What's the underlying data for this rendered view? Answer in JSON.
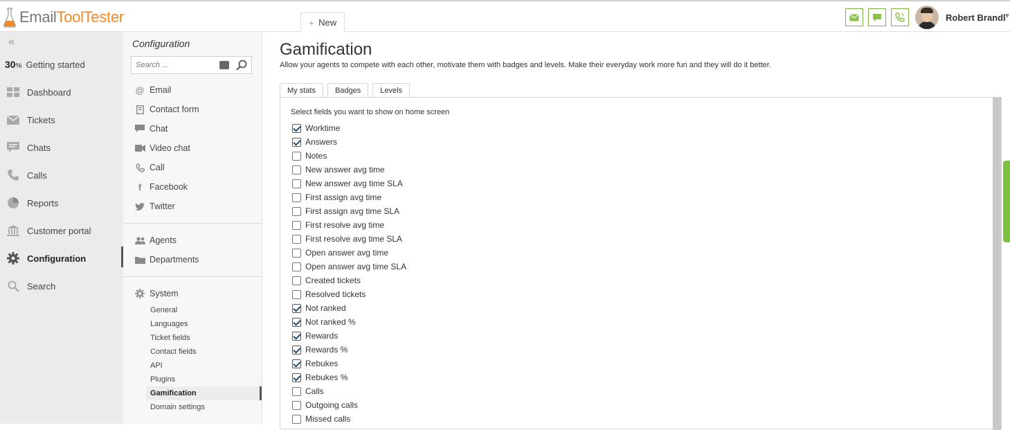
{
  "brand": {
    "part1": "Email",
    "part2": "ToolTester"
  },
  "header": {
    "new_tab_label": "New",
    "user_name": "Robert Brandl",
    "icons": [
      "email-icon",
      "chat-icon",
      "phone-icon"
    ],
    "accent_color": "#7cb342"
  },
  "leftnav": {
    "progress": {
      "percent": "30",
      "unit": "%",
      "label": "Getting started"
    },
    "items": [
      {
        "label": "Dashboard",
        "icon": "dashboard-icon"
      },
      {
        "label": "Tickets",
        "icon": "envelope-icon"
      },
      {
        "label": "Chats",
        "icon": "chat-bubble-icon"
      },
      {
        "label": "Calls",
        "icon": "phone-icon"
      },
      {
        "label": "Reports",
        "icon": "pie-chart-icon"
      },
      {
        "label": "Customer portal",
        "icon": "portal-icon"
      },
      {
        "label": "Configuration",
        "icon": "gear-icon",
        "active": true
      },
      {
        "label": "Search",
        "icon": "search-icon"
      }
    ]
  },
  "config": {
    "title": "Configuration",
    "search_placeholder": "Search ...",
    "channels": [
      {
        "label": "Email",
        "icon": "at-icon"
      },
      {
        "label": "Contact form",
        "icon": "form-icon"
      },
      {
        "label": "Chat",
        "icon": "chat-bubble-icon"
      },
      {
        "label": "Video chat",
        "icon": "video-icon"
      },
      {
        "label": "Call",
        "icon": "phone-icon"
      },
      {
        "label": "Facebook",
        "icon": "facebook-icon"
      },
      {
        "label": "Twitter",
        "icon": "twitter-icon"
      }
    ],
    "people": [
      {
        "label": "Agents",
        "icon": "agents-icon"
      },
      {
        "label": "Departments",
        "icon": "folder-icon"
      }
    ],
    "system": {
      "label": "System",
      "sub_items": [
        "General",
        "Languages",
        "Ticket fields",
        "Contact fields",
        "API",
        "Plugins",
        "Gamification",
        "Domain settings"
      ],
      "active": "Gamification"
    }
  },
  "main": {
    "title": "Gamification",
    "description": "Allow your agents to compete with each other, motivate them with badges and levels. Make their everyday work more fun and they will do it better.",
    "tabs": [
      "My stats",
      "Badges",
      "Levels"
    ],
    "active_tab": "My stats",
    "fields_label": "Select fields you want to show on home screen",
    "fields": [
      {
        "label": "Worktime",
        "checked": true
      },
      {
        "label": "Answers",
        "checked": true
      },
      {
        "label": "Notes",
        "checked": false
      },
      {
        "label": "New answer avg time",
        "checked": false
      },
      {
        "label": "New answer avg time SLA",
        "checked": false
      },
      {
        "label": "First assign avg time",
        "checked": false
      },
      {
        "label": "First assign avg time SLA",
        "checked": false
      },
      {
        "label": "First resolve avg time",
        "checked": false
      },
      {
        "label": "First resolve avg time SLA",
        "checked": false
      },
      {
        "label": "Open answer avg time",
        "checked": false
      },
      {
        "label": "Open answer avg time SLA",
        "checked": false
      },
      {
        "label": "Created tickets",
        "checked": false
      },
      {
        "label": "Resolved tickets",
        "checked": false
      },
      {
        "label": "Not ranked",
        "checked": true
      },
      {
        "label": "Not ranked %",
        "checked": true
      },
      {
        "label": "Rewards",
        "checked": true
      },
      {
        "label": "Rewards %",
        "checked": true
      },
      {
        "label": "Rebukes",
        "checked": true
      },
      {
        "label": "Rebukes %",
        "checked": true
      },
      {
        "label": "Calls",
        "checked": false
      },
      {
        "label": "Outgoing calls",
        "checked": false
      },
      {
        "label": "Missed calls",
        "checked": false
      }
    ]
  }
}
